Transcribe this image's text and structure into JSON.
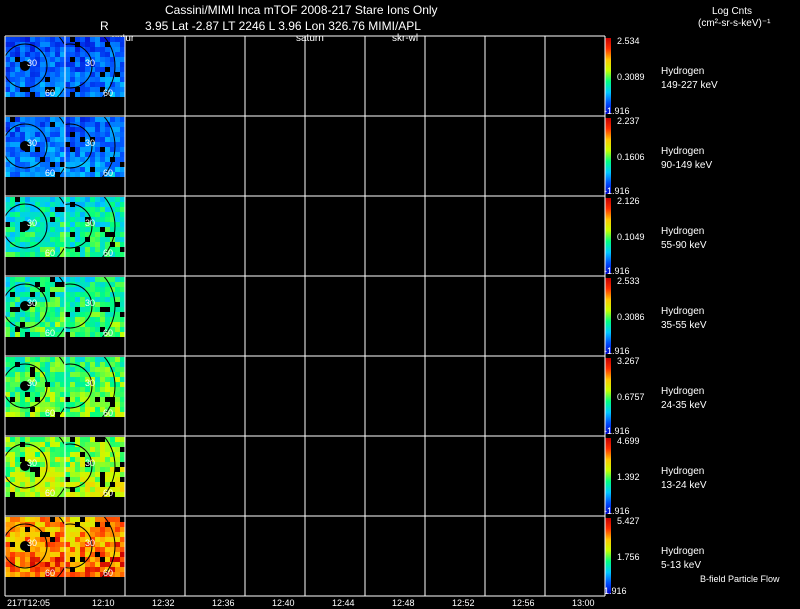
{
  "header": {
    "title": "Cassini/MIMI Inca mTOF  2008-217   Stare    Ions Only",
    "r_label": "R",
    "info": "3.95 Lat -2.87 LT 2246 L        3.96 Lon        326.76  MIMI/APL",
    "annot_saturn_1": "satur",
    "annot_saturn_2": "saturn",
    "annot_skr": "skr-wl"
  },
  "units": {
    "line1": "Log Cnts",
    "line2": "(cm²-sr-s-keV)⁻¹"
  },
  "footer_note": "B-field Particle Flow",
  "ring_labels": [
    "30",
    "60"
  ],
  "colors": {
    "background": "#000000",
    "grid": "#ffffff",
    "colorbar": [
      "#0000c8",
      "#0050ff",
      "#00c8ff",
      "#00ff80",
      "#c8ff00",
      "#ffc800",
      "#ff3000",
      "#c80000"
    ]
  },
  "chart_data": {
    "type": "heatmap",
    "x_tick_labels": [
      "217T12:05",
      "12:10",
      "12:32",
      "12:36",
      "12:40",
      "12:44",
      "12:48",
      "12:52",
      "12:56",
      "13:00"
    ],
    "rows": [
      {
        "species": "Hydrogen",
        "energy": "149-227 keV",
        "cbar_max": "2.534",
        "cbar_mid": "0.3089",
        "cbar_min": "-1.916",
        "level": 0.12
      },
      {
        "species": "Hydrogen",
        "energy": "90-149 keV",
        "cbar_max": "2.237",
        "cbar_mid": "0.1606",
        "cbar_min": "-1.916",
        "level": 0.15
      },
      {
        "species": "Hydrogen",
        "energy": "55-90 keV",
        "cbar_max": "2.126",
        "cbar_mid": "0.1049",
        "cbar_min": "-1.916",
        "level": 0.38
      },
      {
        "species": "Hydrogen",
        "energy": "35-55 keV",
        "cbar_max": "2.533",
        "cbar_mid": "0.3086",
        "cbar_min": "-1.916",
        "level": 0.42
      },
      {
        "species": "Hydrogen",
        "energy": "24-35 keV",
        "cbar_max": "3.267",
        "cbar_mid": "0.6757",
        "cbar_min": "-1.916",
        "level": 0.48
      },
      {
        "species": "Hydrogen",
        "energy": "13-24 keV",
        "cbar_max": "4.699",
        "cbar_mid": "1.392",
        "cbar_min": "-1.916",
        "level": 0.55
      },
      {
        "species": "Hydrogen",
        "energy": "5-13 keV",
        "cbar_max": "5.427",
        "cbar_mid": "1.756",
        "cbar_min": "1.916",
        "level": 0.78
      }
    ]
  }
}
